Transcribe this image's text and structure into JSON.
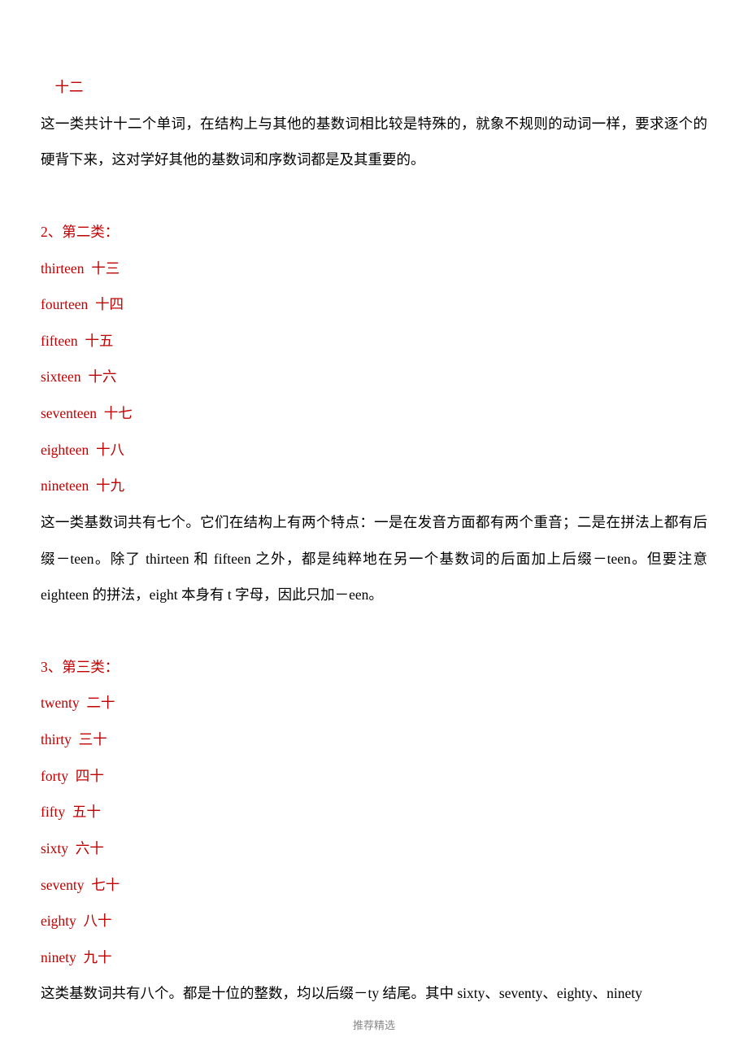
{
  "top_fragment": "十二",
  "para1": "这一类共计十二个单词，在结构上与其他的基数词相比较是特殊的，就象不规则的动词一样，要求逐个的硬背下来，这对学好其他的基数词和序数词都是及其重要的。",
  "section2": {
    "header": "2、第二类：",
    "items": [
      {
        "en": "thirteen",
        "zh": "十三"
      },
      {
        "en": "fourteen",
        "zh": "十四"
      },
      {
        "en": "fifteen",
        "zh": "十五"
      },
      {
        "en": "sixteen",
        "zh": "十六"
      },
      {
        "en": "seventeen",
        "zh": "十七"
      },
      {
        "en": "eighteen",
        "zh": "十八"
      },
      {
        "en": "nineteen",
        "zh": "十九"
      }
    ],
    "para_before": "这一类基数词共有七个。它们在结构上有两个特点：一是在发音方面都有两个重音；二是在拼法上都有后缀－teen。除了 thirteen 和 fifteen 之外，都是纯粹地在另一个基数词的后面加上后缀－teen。但要注意 eighteen 的拼法，eight 本身有 t 字母，因此只加－een。"
  },
  "section3": {
    "header": "3、第三类：",
    "items": [
      {
        "en": "twenty",
        "zh": "二十"
      },
      {
        "en": "thirty",
        "zh": "三十"
      },
      {
        "en": "forty",
        "zh": "四十"
      },
      {
        "en": "fifty",
        "zh": "五十"
      },
      {
        "en": "sixty",
        "zh": "六十"
      },
      {
        "en": "seventy",
        "zh": "七十"
      },
      {
        "en": "eighty",
        "zh": "八十"
      },
      {
        "en": "ninety",
        "zh": "九十"
      }
    ],
    "para": "这类基数词共有八个。都是十位的整数，均以后缀－ty 结尾。其中 sixty、seventy、eighty、ninety"
  },
  "footer": "推荐精选"
}
